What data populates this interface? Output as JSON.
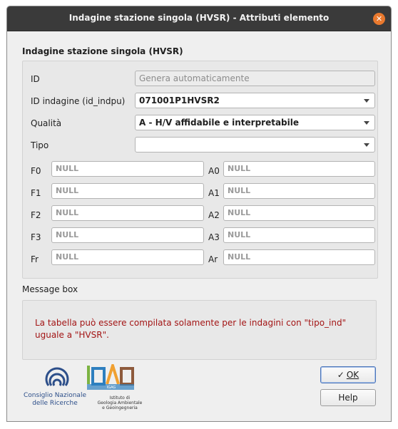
{
  "window": {
    "title": "Indagine stazione singola (HVSR) - Attributi elemento",
    "close_glyph": "✕"
  },
  "form": {
    "group_title": "Indagine stazione singola (HVSR)",
    "id": {
      "label": "ID",
      "placeholder": "Genera automaticamente"
    },
    "id_indagine": {
      "label": "ID indagine (id_indpu)",
      "value": "071001P1HVSR2"
    },
    "qualita": {
      "label": "Qualità",
      "value": "A - H/V affidabile e interpretabile"
    },
    "tipo": {
      "label": "Tipo",
      "value": ""
    },
    "params_left": [
      {
        "label": "F0",
        "value": "NULL"
      },
      {
        "label": "F1",
        "value": "NULL"
      },
      {
        "label": "F2",
        "value": "NULL"
      },
      {
        "label": "F3",
        "value": "NULL"
      },
      {
        "label": "Fr",
        "value": "NULL"
      }
    ],
    "params_right": [
      {
        "label": "A0",
        "value": "NULL"
      },
      {
        "label": "A1",
        "value": "NULL"
      },
      {
        "label": "A2",
        "value": "NULL"
      },
      {
        "label": "A3",
        "value": "NULL"
      },
      {
        "label": "Ar",
        "value": "NULL"
      }
    ]
  },
  "message_box": {
    "title": "Message box",
    "text_line1": "La tabella può essere compilata solamente per le indagini con \"tipo_ind\"",
    "text_line2": "uguale a \"HVSR\"."
  },
  "buttons": {
    "ok_label": "OK",
    "ok_icon": "✓",
    "help_label": "Help"
  },
  "logos": {
    "cnr_line1": "Consiglio Nazionale",
    "cnr_line2": "delle Ricerche",
    "igag_wordmark": "IGAG",
    "igag_line1": "Istituto di",
    "igag_line2": "Geologia Ambientale",
    "igag_line3": "e Geoingegneria"
  },
  "colors": {
    "titlebar": "#3a3a3a",
    "close_button": "#e9792e",
    "message_text": "#a31515",
    "default_button_border": "#4a74b8"
  }
}
